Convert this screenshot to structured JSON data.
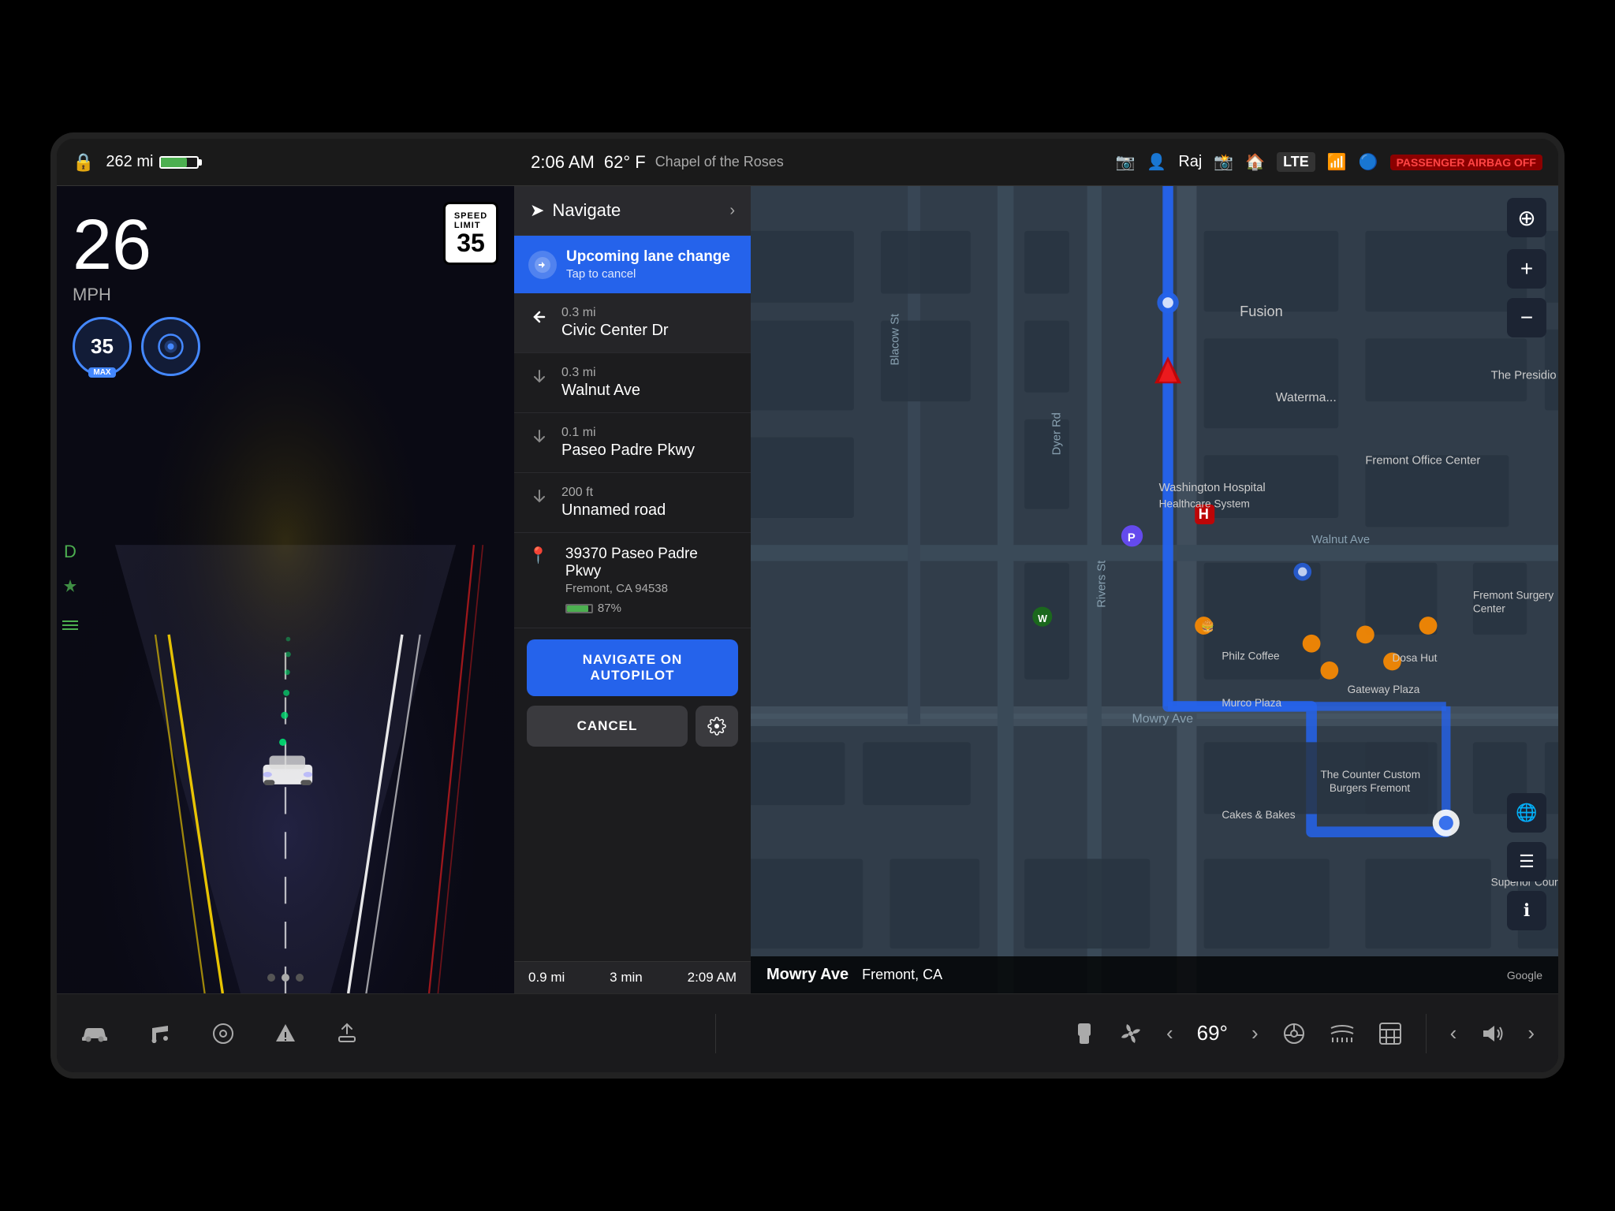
{
  "statusBar": {
    "battery": "262 mi",
    "time": "2:06 AM",
    "temperature": "62° F",
    "location": "Chapel of the Roses",
    "user": "Raj",
    "lte": "LTE",
    "airbag": "PASSENGER AIRBAG OFF"
  },
  "autopilot": {
    "speed": "26",
    "unit": "MPH",
    "setSpeed": "35",
    "maxLabel": "MAX",
    "speedLimit": "35",
    "speedLimitLabel": "SPEED LIMIT"
  },
  "navigation": {
    "title": "Navigate",
    "laneChange": {
      "title": "Upcoming lane change",
      "subtitle": "Tap to cancel"
    },
    "steps": [
      {
        "distance": "0.3 mi",
        "road": "Civic Center Dr",
        "primary": true
      },
      {
        "distance": "0.3 mi",
        "road": "Walnut Ave"
      },
      {
        "distance": "0.1 mi",
        "road": "Paseo Padre Pkwy"
      },
      {
        "distance": "200 ft",
        "road": "Unnamed road"
      }
    ],
    "destination": {
      "name": "39370 Paseo Padre Pkwy",
      "sub": "Fremont, CA 94538",
      "battery": "87%"
    },
    "buttons": {
      "autopilot": "NAVIGATE ON AUTOPILOT",
      "cancel": "CANCEL"
    },
    "footer": {
      "distance": "0.9 mi",
      "time": "3 min",
      "eta": "2:09 AM"
    }
  },
  "map": {
    "location": "Mowry Ave",
    "city": "Fremont, CA",
    "googleBadge": "Google"
  },
  "toolbar": {
    "left": {
      "car": "🚗",
      "music": "🎵",
      "circle": "⊙",
      "flag": "⚑",
      "upload": "⬆"
    },
    "right": {
      "seat": "💺",
      "fan": "⟳",
      "tempLeft": "<",
      "temp": "69°",
      "tempRight": ">",
      "phone": "📱",
      "heat": "≈",
      "grid": "⊞",
      "volLeft": "<",
      "vol": "🔊",
      "volRight": ">"
    }
  }
}
